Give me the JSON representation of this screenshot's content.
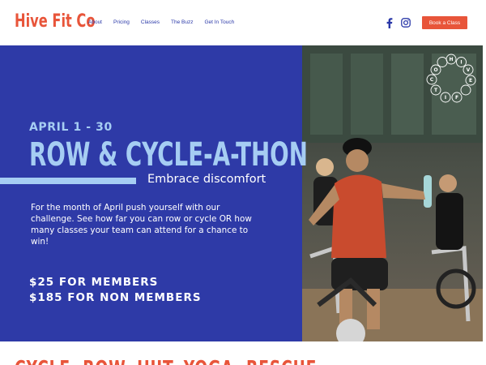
{
  "brand": {
    "name": "Hive Fit Co",
    "accent": "#e8553a",
    "navy": "#2e3aa7",
    "light_blue": "#a6cdf3"
  },
  "nav": {
    "items": [
      "About",
      "Pricing",
      "Classes",
      "The Buzz",
      "Get In Touch"
    ]
  },
  "social": {
    "icons": [
      "facebook-icon",
      "instagram-icon"
    ]
  },
  "cta": {
    "label": "Book a Class"
  },
  "hero": {
    "dates": "APRIL 1 - 30",
    "headline": "ROW & CYCLE-A-THON",
    "tagline": "Embrace discomfort",
    "description": "For the month of April push yourself with our challenge. See how far you can row or cycle OR how many classes your team can attend for a chance to win!",
    "price_members": "$25 FOR MEMBERS",
    "price_non_members": "$185 FOR NON MEMBERS"
  },
  "badge": {
    "letters": [
      "H",
      "I",
      "V",
      "E",
      "F",
      "I",
      "T",
      "C",
      "O"
    ]
  },
  "section": {
    "heading": "CYCLE. ROW. HIIT. YOGA. RESCUE"
  }
}
